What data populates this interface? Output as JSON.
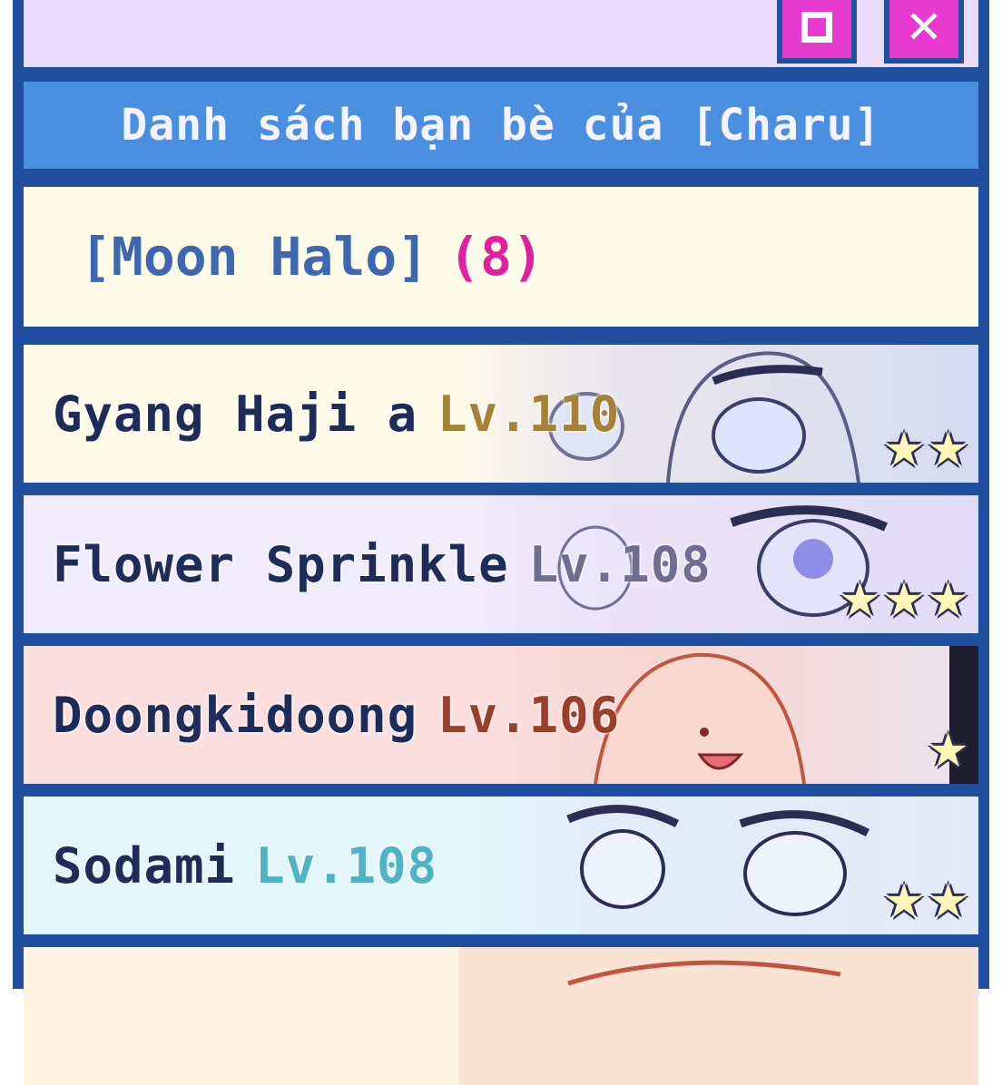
{
  "window": {
    "maximize_icon": "square-icon",
    "close_icon": "close-icon",
    "accent_color": "#e73ad0",
    "frame_color": "#1f4f9e"
  },
  "header": {
    "title": "Danh sách bạn bè của [Charu]"
  },
  "group": {
    "name": "[Moon Halo]",
    "count": "(8)"
  },
  "friends": [
    {
      "name": "Gyang Haji a",
      "level": "Lv.110",
      "level_color": "#a68236",
      "stars": 2,
      "bg": "#fffbe9"
    },
    {
      "name": "Flower Sprinkle",
      "level": "Lv.108",
      "level_color": "#6f6e90",
      "stars": 3,
      "bg": "#f1ecfb"
    },
    {
      "name": "Doongkidoong",
      "level": "Lv.106",
      "level_color": "#9a3f2a",
      "stars": 1,
      "bg": "#fbdede"
    },
    {
      "name": "Sodami",
      "level": "Lv.108",
      "level_color": "#4fb3c4",
      "stars": 2,
      "bg": "#e3f6fb"
    }
  ]
}
